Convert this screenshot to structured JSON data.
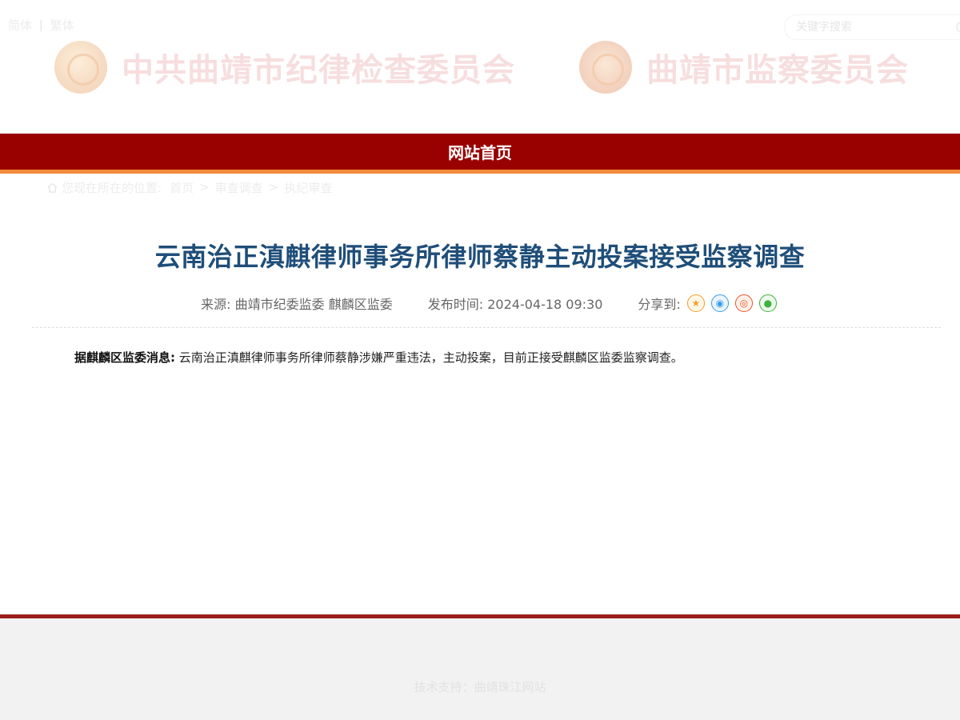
{
  "header": {
    "lang_simplified": "简体",
    "lang_separator": "|",
    "lang_traditional": "繁体",
    "search_placeholder": "关键字搜索",
    "org_party": "中共曲靖市纪律检查委员会",
    "org_supervision": "曲靖市监察委员会"
  },
  "nav": {
    "home": "网站首页"
  },
  "breadcrumb": {
    "prefix": "您现在所在的位置:",
    "items": [
      "首页",
      "审查调查",
      "执纪审查"
    ],
    "separator": ">"
  },
  "article": {
    "title": "云南治正滇麒律师事务所律师蔡静主动投案接受监察调查",
    "source": "来源: 曲靖市纪委监委 麒麟区监委",
    "published": "发布时间: 2024-04-18 09:30",
    "share_label": "分享到:",
    "lead": "据麒麟区监委消息:",
    "body": "云南治正滇麒律师事务所律师蔡静涉嫌严重违法，主动投案，目前正接受麒麟区监委监察调查。"
  },
  "footer": {
    "support": "技术支持：曲靖珠江网站"
  },
  "colors": {
    "nav_red": "#990000",
    "nav_accent": "#f18a3c",
    "title_blue": "#1f4e79",
    "footer_bg": "#f2f2f2"
  },
  "icons": [
    "home-icon",
    "search-icon",
    "star-icon",
    "qq-icon",
    "weibo-icon",
    "wechat-icon"
  ]
}
